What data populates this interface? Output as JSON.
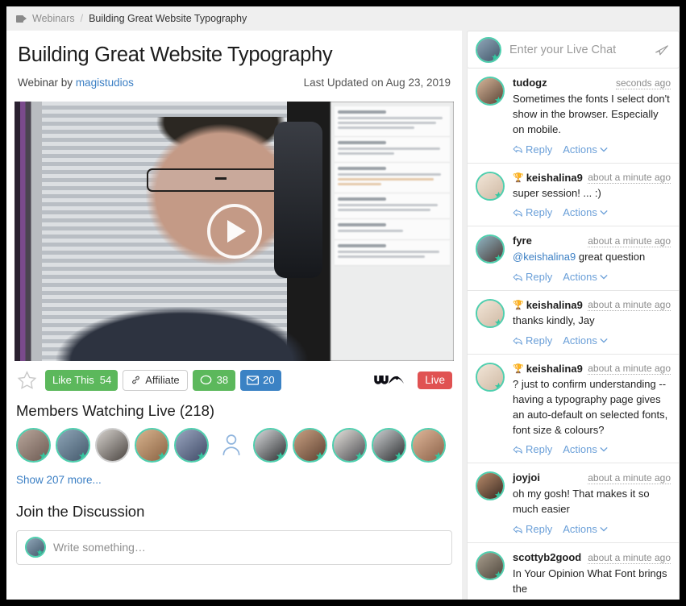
{
  "breadcrumb": {
    "icon": "video-camera-icon",
    "parent": "Webinars",
    "separator": "/",
    "current": "Building Great Website Typography"
  },
  "webinar": {
    "title": "Building Great Website Typography",
    "by_label": "Webinar by",
    "author": "magistudios",
    "updated": "Last Updated on Aug 23, 2019",
    "play_icon": "play-icon"
  },
  "actions": {
    "star_icon": "star-outline-icon",
    "like_label": "Like This",
    "like_count": "54",
    "affiliate_label": "Affiliate",
    "affiliate_icon": "link-icon",
    "comment_icon": "comment-icon",
    "comment_count": "38",
    "message_icon": "envelope-icon",
    "message_count": "20",
    "brand_logo": "wa-logo",
    "live_label": "Live",
    "colors": {
      "green": "#5cb85c",
      "blue": "#3b82c4",
      "red": "#e05252",
      "teal": "#4ecfae",
      "link": "#3b7fc4"
    }
  },
  "members": {
    "heading": "Members Watching Live (218)",
    "show_more": "Show 207 more...",
    "avatars": [
      {
        "name": "member-avatar-1",
        "bg": "linear-gradient(140deg,#b9a79c,#6d5a52)",
        "ring": true
      },
      {
        "name": "member-avatar-2",
        "bg": "linear-gradient(140deg,#8fa6b8,#43586b)",
        "ring": true
      },
      {
        "name": "member-avatar-3",
        "bg": "linear-gradient(140deg,#d6d2cd,#4a4440)",
        "ring": false
      },
      {
        "name": "member-avatar-4",
        "bg": "linear-gradient(140deg,#d8b48f,#8a6242)",
        "ring": true
      },
      {
        "name": "member-avatar-5",
        "bg": "linear-gradient(140deg,#9aa6c0,#3f4a66)",
        "ring": true
      },
      {
        "name": "member-avatar-ghost",
        "bg": "none",
        "ring": false,
        "ghost": true
      },
      {
        "name": "member-avatar-6",
        "bg": "linear-gradient(140deg,#d9dbdd,#2c2e30)",
        "ring": true
      },
      {
        "name": "member-avatar-7",
        "bg": "linear-gradient(140deg,#c9a183,#5d4030)",
        "ring": true
      },
      {
        "name": "member-avatar-8",
        "bg": "linear-gradient(140deg,#e6e3dd,#4a4a4f)",
        "ring": true
      },
      {
        "name": "member-avatar-9",
        "bg": "linear-gradient(140deg,#cfd2d4,#2b2d2f)",
        "ring": true
      },
      {
        "name": "member-avatar-10",
        "bg": "linear-gradient(140deg,#e0b79a,#8a6148)",
        "ring": true
      }
    ]
  },
  "discussion": {
    "heading": "Join the Discussion",
    "placeholder": "Write something…"
  },
  "chat": {
    "input_placeholder": "Enter your Live Chat",
    "send_icon": "send-icon",
    "reply_label": "Reply",
    "actions_label": "Actions",
    "messages": [
      {
        "user": "tudogz",
        "badge": "",
        "time": "seconds ago",
        "text": "Sometimes the fonts I select don't show in the browser. Especially on mobile.",
        "avatar_bg": "linear-gradient(140deg,#d7b69a,#5a4436)"
      },
      {
        "user": "keishalina9",
        "badge": "🏆",
        "time": "about a minute ago",
        "text": "super session! ... :)",
        "avatar_bg": "linear-gradient(140deg,#f2e6d8,#cfb9a4)"
      },
      {
        "user": "fyre",
        "badge": "",
        "time": "about a minute ago",
        "mention": "@keishalina9",
        "text": " great question",
        "avatar_bg": "linear-gradient(140deg,#8fb6c4,#4a3a36)"
      },
      {
        "user": "keishalina9",
        "badge": "🏆",
        "time": "about a minute ago",
        "text": "thanks kindly, Jay",
        "avatar_bg": "linear-gradient(140deg,#f2e6d8,#cfb9a4)"
      },
      {
        "user": "keishalina9",
        "badge": "🏆",
        "time": "about a minute ago",
        "text": "? just to confirm understanding -- having a typography page gives an auto-default on selected fonts, font size & colours?",
        "avatar_bg": "linear-gradient(140deg,#f2e6d8,#cfb9a4)"
      },
      {
        "user": "joyjoi",
        "badge": "",
        "time": "about a minute ago",
        "text": "oh my gosh! That makes it so much easier",
        "avatar_bg": "linear-gradient(140deg,#b98b6a,#3a2a22)"
      },
      {
        "user": "scottyb2good",
        "badge": "",
        "time": "about a minute ago",
        "text": "In Your Opinion What Font brings the",
        "avatar_bg": "linear-gradient(140deg,#a99e8e,#4e463c)"
      }
    ]
  }
}
